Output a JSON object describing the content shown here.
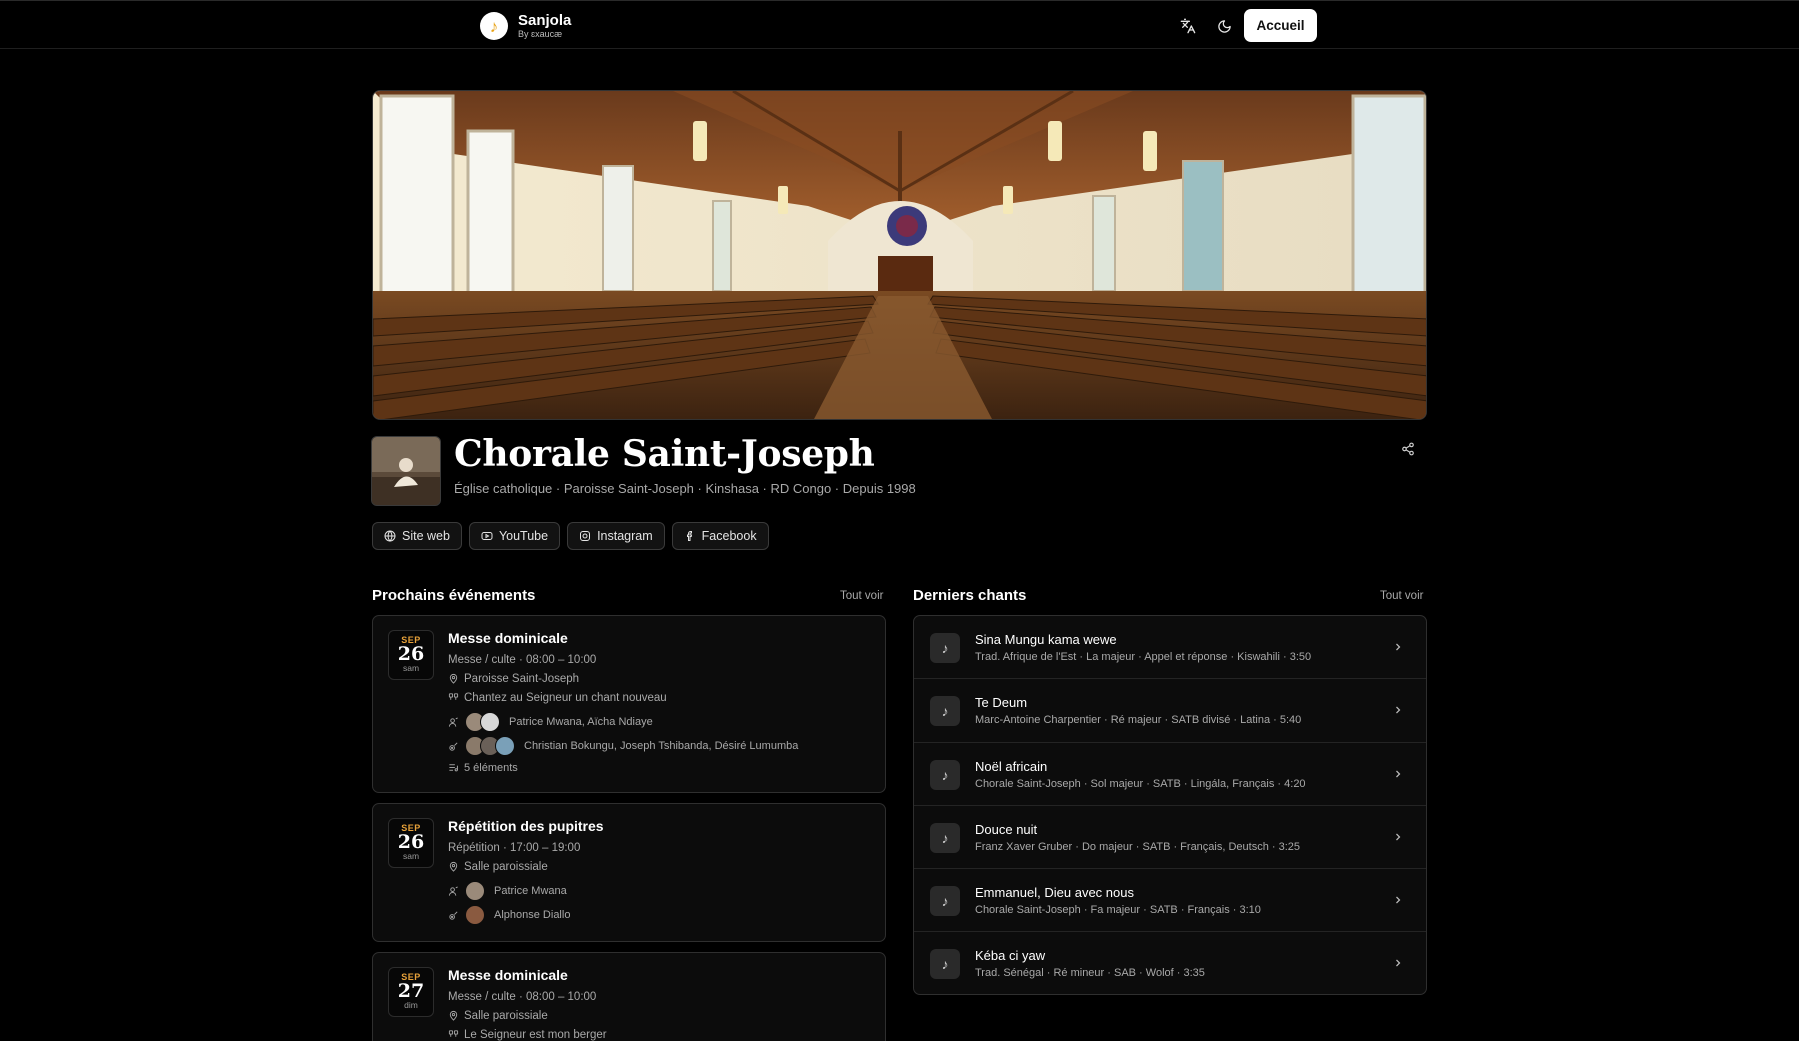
{
  "header": {
    "brand_name": "Sanjola",
    "brand_sub": "By ɛxaucæ",
    "translate_icon": "translate-icon",
    "theme_icon": "moon-icon",
    "home_button": "Accueil"
  },
  "profile": {
    "title": "Chorale Saint-Joseph",
    "meta": "Église catholique · Paroisse Saint-Joseph · Kinshasa · RD Congo · Depuis 1998",
    "share_icon": "share-icon",
    "links": [
      "Site web",
      "YouTube",
      "Instagram",
      "Facebook"
    ]
  },
  "events_section": {
    "title": "Prochains événements",
    "see_all": "Tout voir",
    "items": [
      {
        "month": "SEP",
        "day": "26",
        "weekday": "sam",
        "title": "Messe dominicale",
        "info": "Messe / culte · 08:00 – 10:00",
        "location": "Paroisse Saint-Joseph",
        "theme": "Chantez au Seigneur un chant nouveau",
        "directors": "Patrice Mwana, Aïcha Ndiaye",
        "musicians": "Christian Bokungu, Joseph Tshibanda, Désiré Lumumba",
        "program": "5 éléments"
      },
      {
        "month": "SEP",
        "day": "26",
        "weekday": "sam",
        "title": "Répétition des pupitres",
        "info": "Répétition · 17:00 – 19:00",
        "location": "Salle paroissiale",
        "directors": "Patrice Mwana",
        "musicians": "Alphonse Diallo"
      },
      {
        "month": "SEP",
        "day": "27",
        "weekday": "dim",
        "title": "Messe dominicale",
        "info": "Messe / culte · 08:00 – 10:00",
        "location": "Salle paroissiale",
        "theme": "Le Seigneur est mon berger"
      }
    ]
  },
  "songs_section": {
    "title": "Derniers chants",
    "see_all": "Tout voir",
    "items": [
      {
        "title": "Sina Mungu kama wewe",
        "meta": "Trad. Afrique de l'Est · La majeur · Appel et réponse · Kiswahili · 3:50"
      },
      {
        "title": "Te Deum",
        "meta": "Marc-Antoine Charpentier · Ré majeur · SATB divisé · Latina · 5:40"
      },
      {
        "title": "Noël africain",
        "meta": "Chorale Saint-Joseph · Sol majeur · SATB · Lingála, Français · 4:20"
      },
      {
        "title": "Douce nuit",
        "meta": "Franz Xaver Gruber · Do majeur · SATB · Français, Deutsch · 3:25"
      },
      {
        "title": "Emmanuel, Dieu avec nous",
        "meta": "Chorale Saint-Joseph · Fa majeur · SATB · Français · 3:10"
      },
      {
        "title": "Kéba ci yaw",
        "meta": "Trad. Sénégal · Ré mineur · SAB · Wolof · 3:35"
      }
    ]
  },
  "colors": {
    "accent": "#e8a23a",
    "background": "#000000",
    "card": "#0c0c0c"
  }
}
